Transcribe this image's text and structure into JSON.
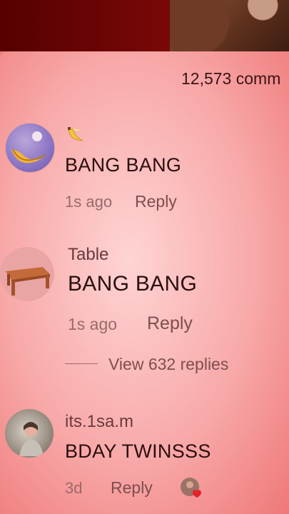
{
  "header": {
    "comment_count": "12,573 comm"
  },
  "comments": [
    {
      "username": "",
      "username_emoji": "banana-icon",
      "text": "BANG BANG",
      "time": "1s ago",
      "reply_label": "Reply",
      "avatar": "banana-sunset-avatar"
    },
    {
      "username": "Table",
      "text": "BANG BANG",
      "time": "1s ago",
      "reply_label": "Reply",
      "avatar": "table-icon",
      "view_replies": "View 632 replies"
    },
    {
      "username": "its.1sa.m",
      "text": "BDAY TWINSSS",
      "time": "3d",
      "reply_label": "Reply",
      "avatar": "photo-avatar",
      "liked_by_creator": "creator-liked-heart-icon"
    }
  ],
  "colors": {
    "overlay_red": "#f9a5a5",
    "text_dark": "#2a0e0e",
    "text_muted": "#9a6a6a"
  }
}
